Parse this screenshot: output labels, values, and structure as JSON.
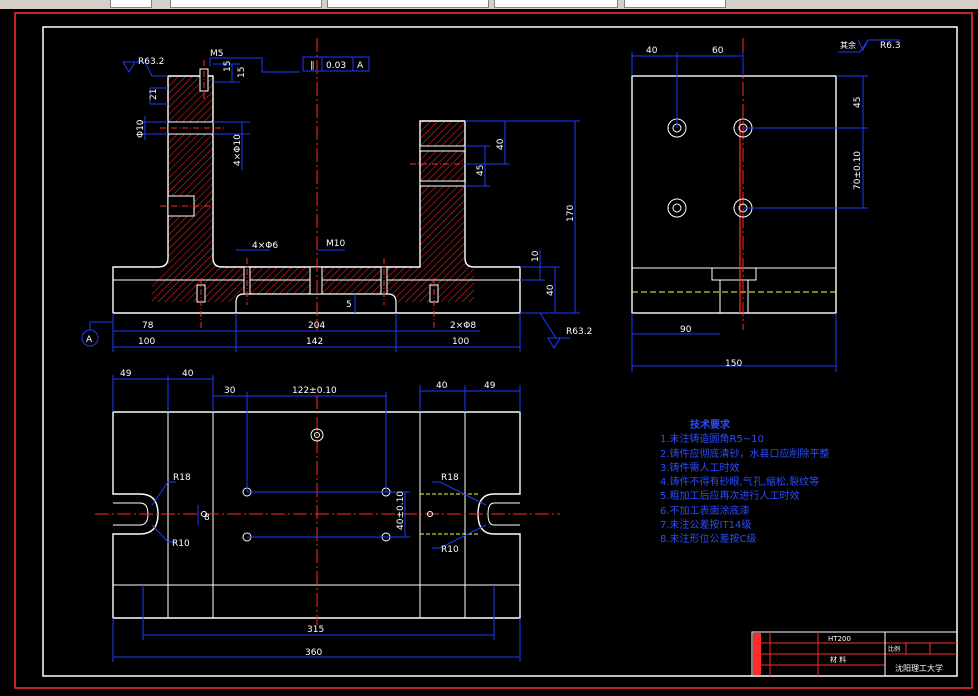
{
  "colors": {
    "background": "#000000",
    "frame": "#ffffff",
    "dim": "#1a3cff",
    "hatch": "#ff2a2a",
    "center": "#ff2a2a",
    "yellow": "#ffff33",
    "note": "#2a4cff"
  },
  "toolbar": {
    "icons": [
      "folder-icon",
      "settings-icon"
    ]
  },
  "gdt": {
    "symbol": "∥",
    "tolerance": "0.03",
    "datum": "A"
  },
  "roughness": {
    "front_top": "R63.2",
    "front_bottom": "R63.2",
    "side": "R6.3",
    "side_prefix": "其余"
  },
  "front_dims": {
    "m5": "M5",
    "d15": "15",
    "d15b": "15",
    "d21": "21",
    "d10a": "Φ10",
    "d4x6_vert": "4×Φ10",
    "d4x6": "4×Φ6",
    "m10": "M10",
    "d45": "45",
    "d40": "40",
    "d170": "170",
    "d10": "10",
    "d40b": "40",
    "d5": "5",
    "d78": "78",
    "d204": "204",
    "d2x8": "2×Φ8",
    "d100": "100",
    "d142": "142",
    "d100b": "100",
    "datum_label": "A"
  },
  "side_dims": {
    "d40": "40",
    "d60": "60",
    "d45": "45",
    "d70": "70±0.10",
    "d90": "90",
    "d150": "150"
  },
  "top_dims": {
    "d49": "49",
    "d40": "40",
    "d30": "30",
    "d122": "122±0.10",
    "d40r": "40",
    "d49r": "49",
    "d40v": "40±0.10",
    "r18": "R18",
    "r18b": "R18",
    "r10": "R10",
    "r10b": "R10",
    "d8": "8",
    "d315": "315",
    "d360": "360"
  },
  "notes": {
    "title": "技术要求",
    "items": [
      "1.未注铸造圆角R5~10",
      "2.铸件应彻底清砂，水县口应削除平整",
      "3.铸件需人工时效",
      "4.铸件不得有砂眼,气孔,缩松,裂纹等",
      "5.粗加工后应再次进行人工时效",
      "6.不加工表面涂底漆",
      "7.未注公差按IT14级",
      "8.未注形位公差按C级"
    ]
  },
  "title_block": {
    "material": "HT200",
    "part": "材 料",
    "school": "沈阳理工大学",
    "field": "比例"
  }
}
